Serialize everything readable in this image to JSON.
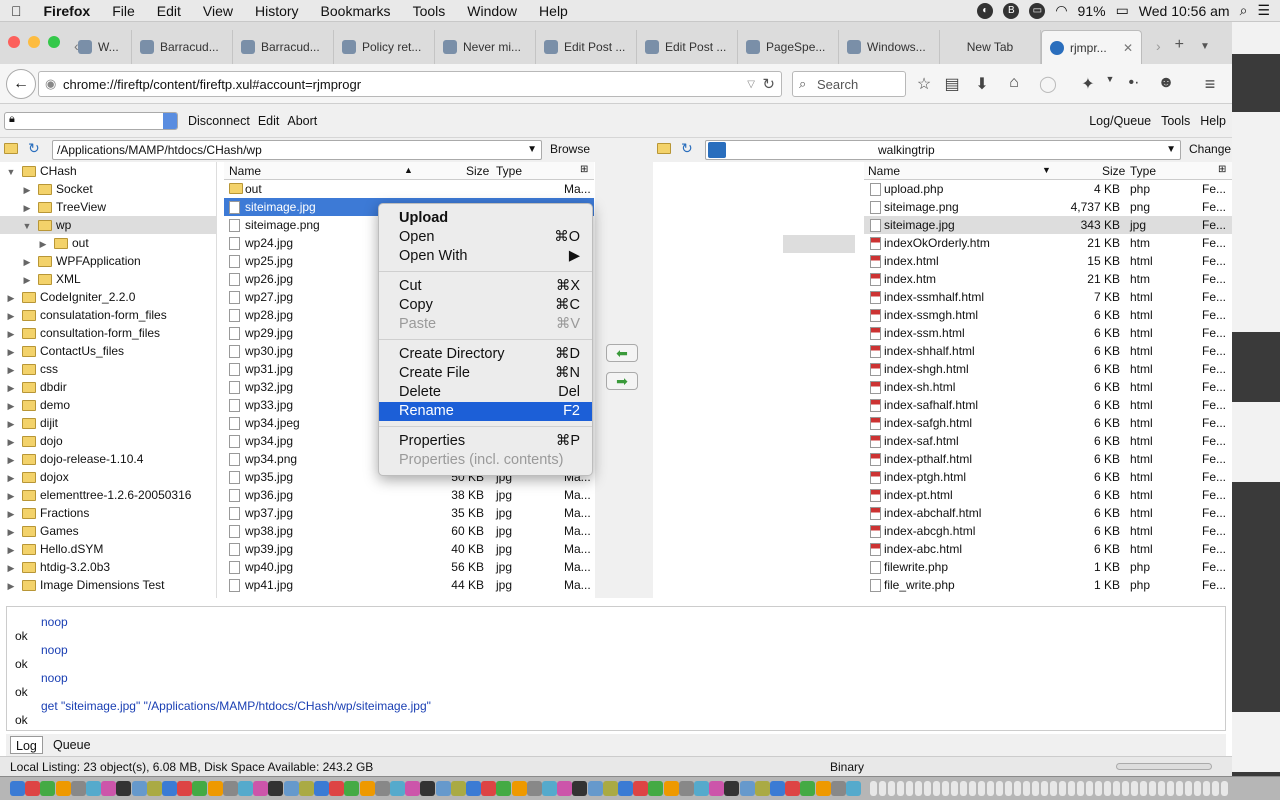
{
  "menubar": {
    "app": "Firefox",
    "items": [
      "File",
      "Edit",
      "View",
      "History",
      "Bookmarks",
      "Tools",
      "Window",
      "Help"
    ],
    "battery": "91%",
    "clock": "Wed 10:56 am"
  },
  "tabs": [
    {
      "label": "W..."
    },
    {
      "label": "Barracud..."
    },
    {
      "label": "Barracud..."
    },
    {
      "label": "Policy ret..."
    },
    {
      "label": "Never mi..."
    },
    {
      "label": "Edit Post ..."
    },
    {
      "label": "Edit Post ..."
    },
    {
      "label": "PageSpe..."
    },
    {
      "label": "Windows..."
    },
    {
      "label": "New Tab"
    },
    {
      "label": "rjmpr..."
    }
  ],
  "navbar": {
    "url": "chrome://fireftp/content/fireftp.xul#account=rjmprogr",
    "search_placeholder": "Search"
  },
  "ftp_toolbar": {
    "disconnect": "Disconnect",
    "edit": "Edit",
    "abort": "Abort",
    "log_queue": "Log/Queue",
    "tools": "Tools",
    "help": "Help"
  },
  "local": {
    "path": "/Applications/MAMP/htdocs/CHash/wp",
    "browse": "Browse",
    "tree": [
      {
        "label": "CHash",
        "depth": 0,
        "twisty": "▼"
      },
      {
        "label": "Socket",
        "depth": 1,
        "twisty": "▶"
      },
      {
        "label": "TreeView",
        "depth": 1,
        "twisty": "▶"
      },
      {
        "label": "wp",
        "depth": 1,
        "twisty": "▼",
        "selected": true
      },
      {
        "label": "out",
        "depth": 2,
        "twisty": "▶"
      },
      {
        "label": "WPFApplication",
        "depth": 1,
        "twisty": "▶"
      },
      {
        "label": "XML",
        "depth": 1,
        "twisty": "▶"
      },
      {
        "label": "CodeIgniter_2.2.0",
        "depth": 0,
        "twisty": "▶"
      },
      {
        "label": "consulatation-form_files",
        "depth": 0,
        "twisty": "▶"
      },
      {
        "label": "consultation-form_files",
        "depth": 0,
        "twisty": "▶"
      },
      {
        "label": "ContactUs_files",
        "depth": 0,
        "twisty": "▶"
      },
      {
        "label": "css",
        "depth": 0,
        "twisty": "▶"
      },
      {
        "label": "dbdir",
        "depth": 0,
        "twisty": "▶"
      },
      {
        "label": "demo",
        "depth": 0,
        "twisty": "▶"
      },
      {
        "label": "dijit",
        "depth": 0,
        "twisty": "▶"
      },
      {
        "label": "dojo",
        "depth": 0,
        "twisty": "▶"
      },
      {
        "label": "dojo-release-1.10.4",
        "depth": 0,
        "twisty": "▶"
      },
      {
        "label": "dojox",
        "depth": 0,
        "twisty": "▶"
      },
      {
        "label": "elementtree-1.2.6-20050316",
        "depth": 0,
        "twisty": "▶"
      },
      {
        "label": "Fractions",
        "depth": 0,
        "twisty": "▶"
      },
      {
        "label": "Games",
        "depth": 0,
        "twisty": "▶"
      },
      {
        "label": "Hello.dSYM",
        "depth": 0,
        "twisty": "▶"
      },
      {
        "label": "htdig-3.2.0b3",
        "depth": 0,
        "twisty": "▶"
      },
      {
        "label": "Image Dimensions Test",
        "depth": 0,
        "twisty": "▶"
      }
    ],
    "columns": {
      "name": "Name",
      "size": "Size",
      "type": "Type"
    },
    "files": [
      {
        "name": "out",
        "size": "",
        "type": "",
        "date": "Ma...",
        "kind": "folder"
      },
      {
        "name": "siteimage.jpg",
        "size": "",
        "type": "",
        "date": "",
        "kind": "doc",
        "selected": true
      },
      {
        "name": "siteimage.png",
        "size": "",
        "type": "",
        "date": "",
        "kind": "doc"
      },
      {
        "name": "wp24.jpg",
        "size": "",
        "type": "",
        "date": "",
        "kind": "doc"
      },
      {
        "name": "wp25.jpg",
        "size": "",
        "type": "",
        "date": "",
        "kind": "doc"
      },
      {
        "name": "wp26.jpg",
        "size": "",
        "type": "",
        "date": "",
        "kind": "doc"
      },
      {
        "name": "wp27.jpg",
        "size": "",
        "type": "",
        "date": "",
        "kind": "doc"
      },
      {
        "name": "wp28.jpg",
        "size": "",
        "type": "",
        "date": "",
        "kind": "doc"
      },
      {
        "name": "wp29.jpg",
        "size": "",
        "type": "",
        "date": "",
        "kind": "doc"
      },
      {
        "name": "wp30.jpg",
        "size": "",
        "type": "",
        "date": "",
        "kind": "doc"
      },
      {
        "name": "wp31.jpg",
        "size": "",
        "type": "",
        "date": "",
        "kind": "doc"
      },
      {
        "name": "wp32.jpg",
        "size": "",
        "type": "",
        "date": "",
        "kind": "doc"
      },
      {
        "name": "wp33.jpg",
        "size": "",
        "type": "",
        "date": "",
        "kind": "doc"
      },
      {
        "name": "wp34.jpeg",
        "size": "",
        "type": "",
        "date": "",
        "kind": "doc"
      },
      {
        "name": "wp34.jpg",
        "size": "",
        "type": "",
        "date": "",
        "kind": "doc"
      },
      {
        "name": "wp34.png",
        "size": "",
        "type": "",
        "date": "",
        "kind": "doc"
      },
      {
        "name": "wp35.jpg",
        "size": "50 KB",
        "type": "jpg",
        "date": "Ma...",
        "kind": "doc"
      },
      {
        "name": "wp36.jpg",
        "size": "38 KB",
        "type": "jpg",
        "date": "Ma...",
        "kind": "doc"
      },
      {
        "name": "wp37.jpg",
        "size": "35 KB",
        "type": "jpg",
        "date": "Ma...",
        "kind": "doc"
      },
      {
        "name": "wp38.jpg",
        "size": "60 KB",
        "type": "jpg",
        "date": "Ma...",
        "kind": "doc"
      },
      {
        "name": "wp39.jpg",
        "size": "40 KB",
        "type": "jpg",
        "date": "Ma...",
        "kind": "doc"
      },
      {
        "name": "wp40.jpg",
        "size": "56 KB",
        "type": "jpg",
        "date": "Ma...",
        "kind": "doc"
      },
      {
        "name": "wp41.jpg",
        "size": "44 KB",
        "type": "jpg",
        "date": "Ma...",
        "kind": "doc"
      }
    ]
  },
  "remote": {
    "path": "walkingtrip",
    "change": "Change",
    "columns": {
      "name": "Name",
      "size": "Size",
      "type": "Type"
    },
    "files": [
      {
        "name": "upload.php",
        "size": "4 KB",
        "type": "php",
        "date": "Fe...",
        "kind": "doc"
      },
      {
        "name": "siteimage.png",
        "size": "4,737 KB",
        "type": "png",
        "date": "Fe...",
        "kind": "doc"
      },
      {
        "name": "siteimage.jpg",
        "size": "343 KB",
        "type": "jpg",
        "date": "Fe...",
        "kind": "doc",
        "gray": true
      },
      {
        "name": "indexOkOrderly.htm",
        "size": "21 KB",
        "type": "htm",
        "date": "Fe...",
        "kind": "html"
      },
      {
        "name": "index.html",
        "size": "15 KB",
        "type": "html",
        "date": "Fe...",
        "kind": "html"
      },
      {
        "name": "index.htm",
        "size": "21 KB",
        "type": "htm",
        "date": "Fe...",
        "kind": "html"
      },
      {
        "name": "index-ssmhalf.html",
        "size": "7 KB",
        "type": "html",
        "date": "Fe...",
        "kind": "html"
      },
      {
        "name": "index-ssmgh.html",
        "size": "6 KB",
        "type": "html",
        "date": "Fe...",
        "kind": "html"
      },
      {
        "name": "index-ssm.html",
        "size": "6 KB",
        "type": "html",
        "date": "Fe...",
        "kind": "html"
      },
      {
        "name": "index-shhalf.html",
        "size": "6 KB",
        "type": "html",
        "date": "Fe...",
        "kind": "html"
      },
      {
        "name": "index-shgh.html",
        "size": "6 KB",
        "type": "html",
        "date": "Fe...",
        "kind": "html"
      },
      {
        "name": "index-sh.html",
        "size": "6 KB",
        "type": "html",
        "date": "Fe...",
        "kind": "html"
      },
      {
        "name": "index-safhalf.html",
        "size": "6 KB",
        "type": "html",
        "date": "Fe...",
        "kind": "html"
      },
      {
        "name": "index-safgh.html",
        "size": "6 KB",
        "type": "html",
        "date": "Fe...",
        "kind": "html"
      },
      {
        "name": "index-saf.html",
        "size": "6 KB",
        "type": "html",
        "date": "Fe...",
        "kind": "html"
      },
      {
        "name": "index-pthalf.html",
        "size": "6 KB",
        "type": "html",
        "date": "Fe...",
        "kind": "html"
      },
      {
        "name": "index-ptgh.html",
        "size": "6 KB",
        "type": "html",
        "date": "Fe...",
        "kind": "html"
      },
      {
        "name": "index-pt.html",
        "size": "6 KB",
        "type": "html",
        "date": "Fe...",
        "kind": "html"
      },
      {
        "name": "index-abchalf.html",
        "size": "6 KB",
        "type": "html",
        "date": "Fe...",
        "kind": "html"
      },
      {
        "name": "index-abcgh.html",
        "size": "6 KB",
        "type": "html",
        "date": "Fe...",
        "kind": "html"
      },
      {
        "name": "index-abc.html",
        "size": "6 KB",
        "type": "html",
        "date": "Fe...",
        "kind": "html"
      },
      {
        "name": "filewrite.php",
        "size": "1 KB",
        "type": "php",
        "date": "Fe...",
        "kind": "doc"
      },
      {
        "name": "file_write.php",
        "size": "1 KB",
        "type": "php",
        "date": "Fe...",
        "kind": "doc"
      }
    ]
  },
  "context_menu": [
    {
      "label": "Upload",
      "shortcut": "",
      "bold": true
    },
    {
      "label": "Open",
      "shortcut": "⌘O"
    },
    {
      "label": "Open With",
      "shortcut": "▶"
    },
    {
      "sep": true
    },
    {
      "label": "Cut",
      "shortcut": "⌘X"
    },
    {
      "label": "Copy",
      "shortcut": "⌘C"
    },
    {
      "label": "Paste",
      "shortcut": "⌘V",
      "disabled": true
    },
    {
      "sep": true
    },
    {
      "label": "Create Directory",
      "shortcut": "⌘D"
    },
    {
      "label": "Create File",
      "shortcut": "⌘N"
    },
    {
      "label": "Delete",
      "shortcut": "Del"
    },
    {
      "label": "Rename",
      "shortcut": "F2",
      "highlighted": true
    },
    {
      "sep": true
    },
    {
      "label": "Properties",
      "shortcut": "⌘P"
    },
    {
      "label": "Properties (incl. contents)",
      "shortcut": "",
      "disabled": true
    }
  ],
  "log": [
    {
      "text": "noop",
      "kind": "cmd"
    },
    {
      "text": "ok",
      "kind": "ok"
    },
    {
      "text": "noop",
      "kind": "cmd"
    },
    {
      "text": "ok",
      "kind": "ok"
    },
    {
      "text": "noop",
      "kind": "cmd"
    },
    {
      "text": "ok",
      "kind": "ok"
    },
    {
      "text": "get \"siteimage.jpg\" \"/Applications/MAMP/htdocs/CHash/wp/siteimage.jpg\"",
      "kind": "cmd"
    },
    {
      "text": "ok",
      "kind": "ok"
    }
  ],
  "log_tabs": {
    "log": "Log",
    "queue": "Queue"
  },
  "status": {
    "left": "Local Listing: 23 object(s), 6.08 MB, Disk Space Available: 243.2 GB",
    "mode": "Binary"
  },
  "colors": {
    "selection": "#3d7ad6",
    "menu_highlight": "#1c5fd7",
    "log_command": "#1a3fb3"
  }
}
